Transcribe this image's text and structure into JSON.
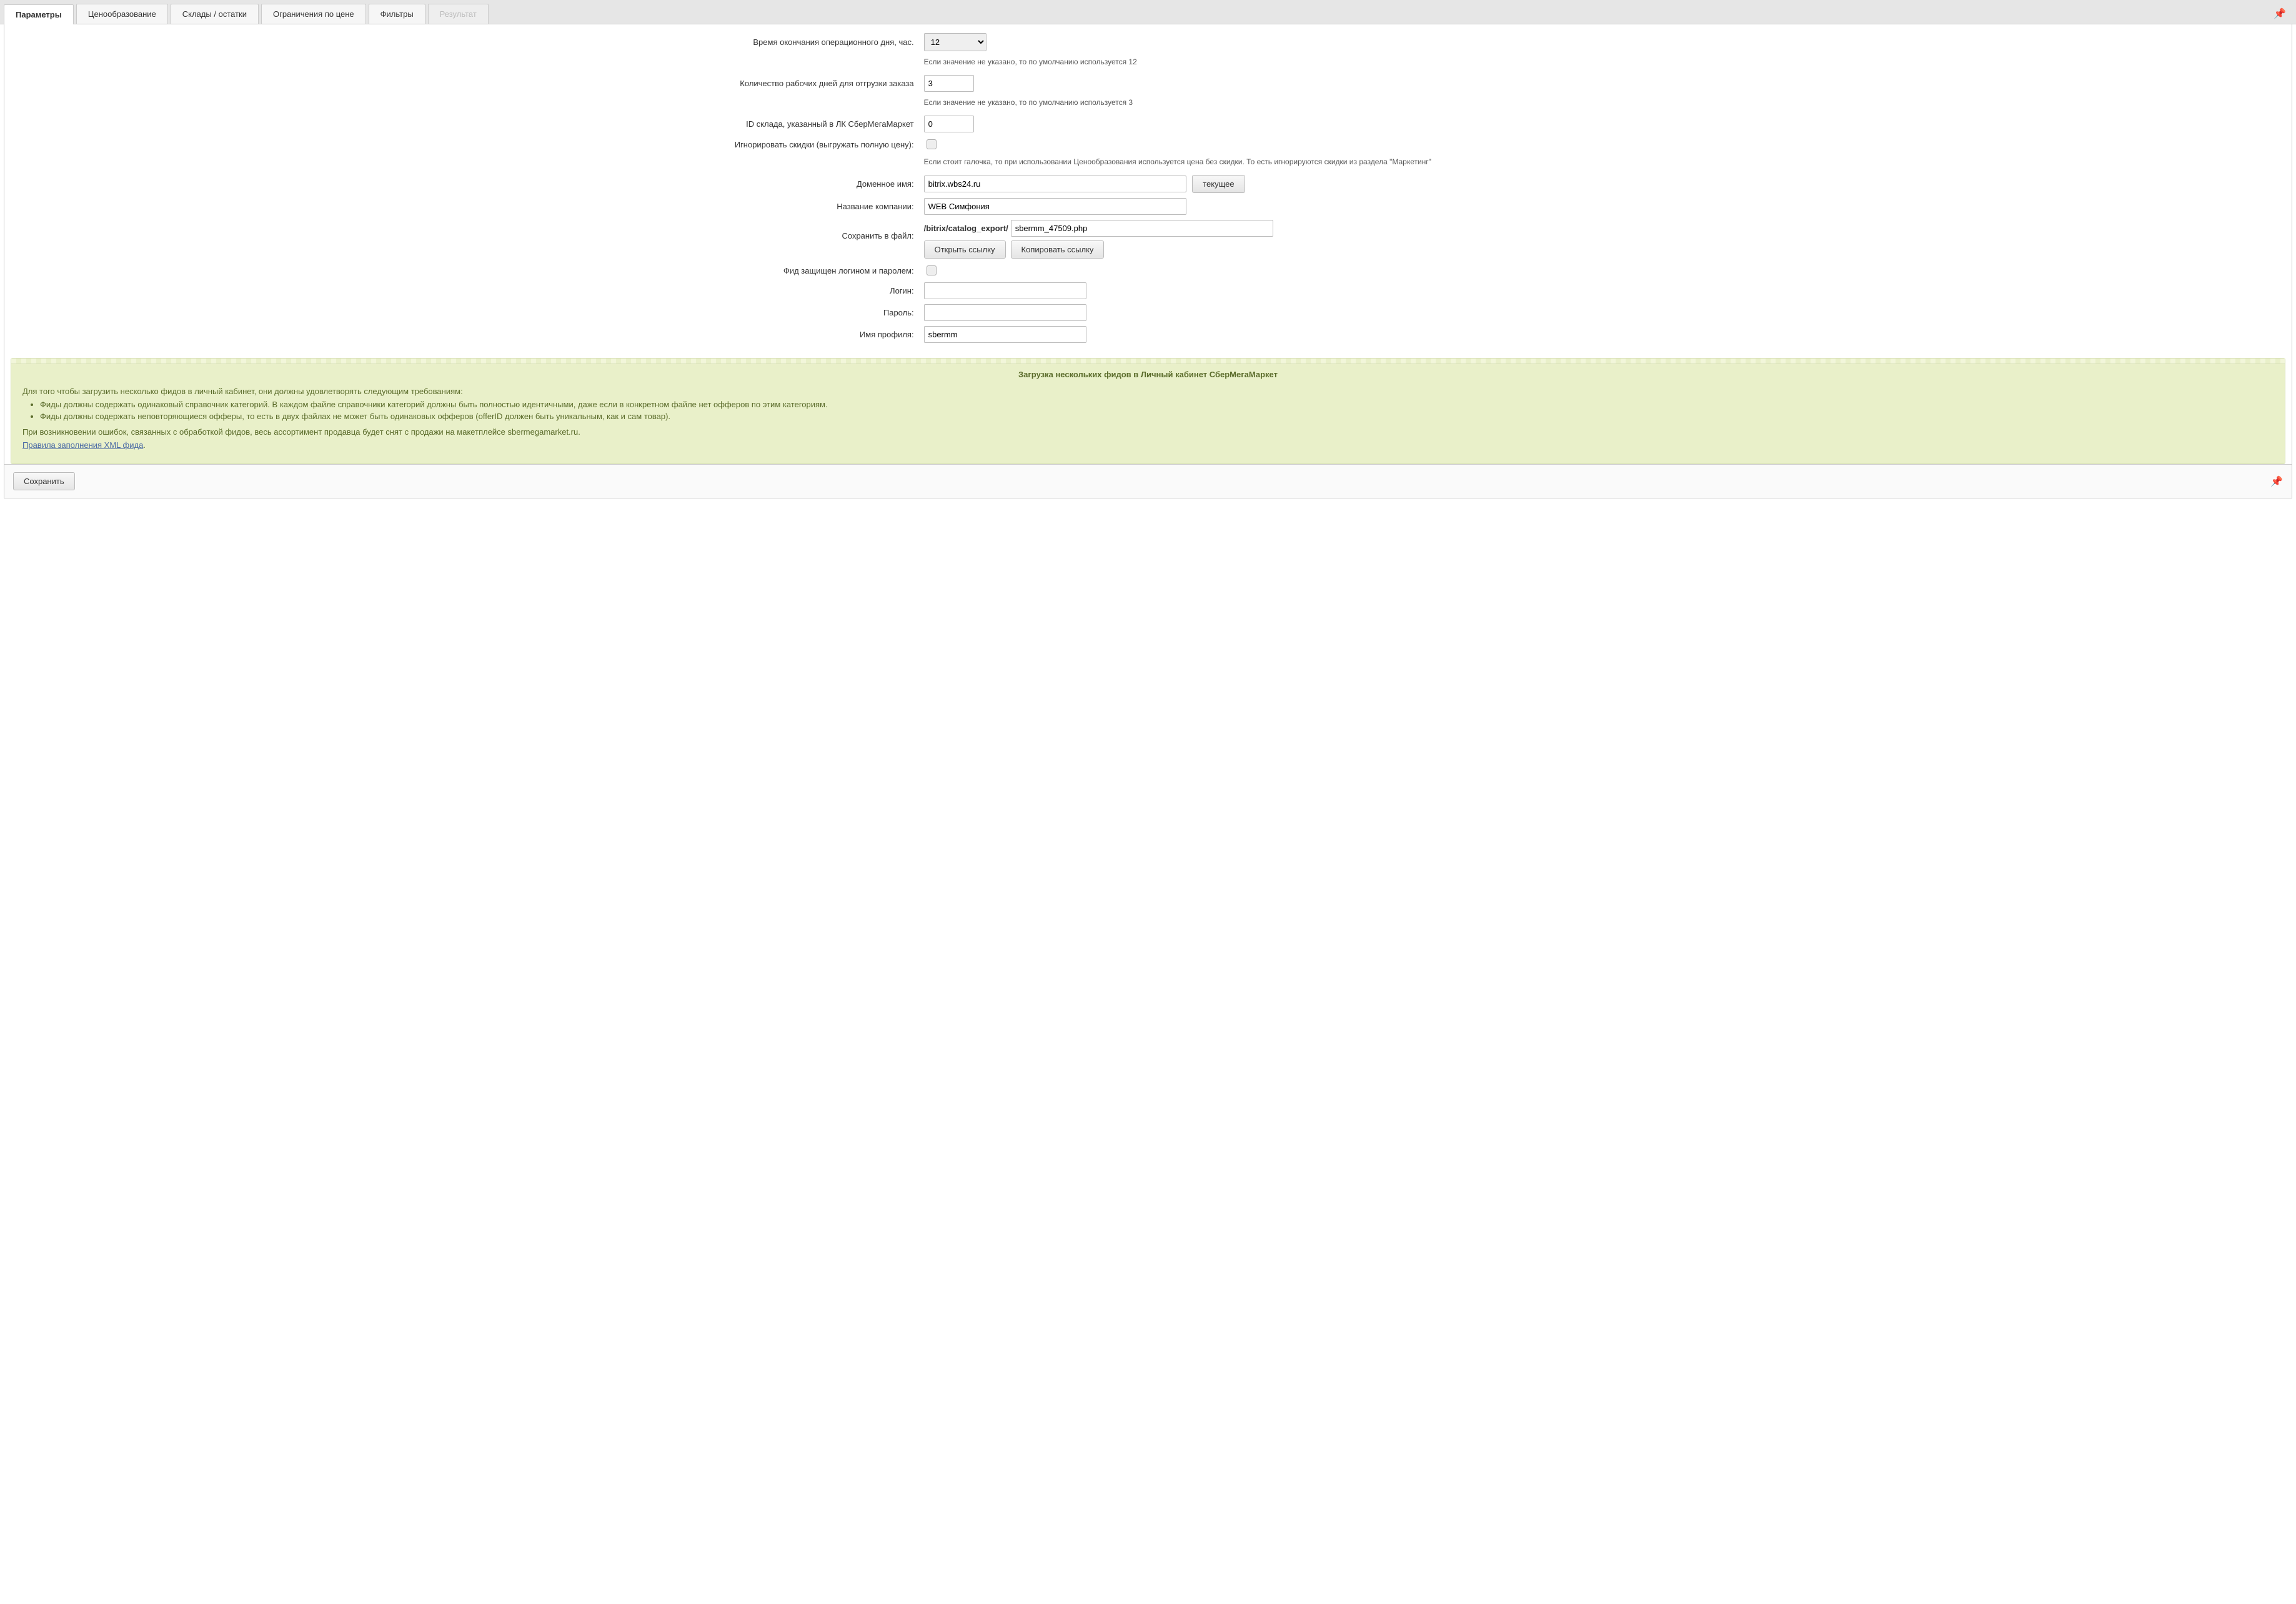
{
  "tabs": {
    "parameters": "Параметры",
    "pricing": "Ценообразование",
    "stocks": "Склады / остатки",
    "price_limits": "Ограничения по цене",
    "filters": "Фильтры",
    "result": "Результат"
  },
  "form": {
    "end_of_day_label": "Время окончания операционного дня, час.",
    "end_of_day_value": "12",
    "end_of_day_hint": "Если значение не указано, то по умолчанию используется 12",
    "workdays_label": "Количество рабочих дней для отгрузки заказа",
    "workdays_value": "3",
    "workdays_hint": "Если значение не указано, то по умолчанию используется 3",
    "warehouse_id_label": "ID склада, указанный в ЛК СберМегаМаркет",
    "warehouse_id_value": "0",
    "ignore_discounts_label": "Игнорировать скидки (выгружать полную цену):",
    "ignore_discounts_hint": "Если стоит галочка, то при использовании Ценообразования используется цена без скидки. То есть игнорируются скидки из раздела \"Маркетинг\"",
    "domain_label": "Доменное имя:",
    "domain_value": "bitrix.wbs24.ru",
    "domain_button": "текущее",
    "company_label": "Название компании:",
    "company_value": "WEB Симфония",
    "save_file_label": "Сохранить в файл:",
    "save_file_prefix": "/bitrix/catalog_export/",
    "save_file_value": "sbermm_47509.php",
    "open_link": "Открыть ссылку",
    "copy_link": "Копировать ссылку",
    "feed_protected_label": "Фид защищен логином и паролем:",
    "login_label": "Логин:",
    "login_value": "",
    "password_label": "Пароль:",
    "password_value": "",
    "profile_label": "Имя профиля:",
    "profile_value": "sbermm"
  },
  "notice": {
    "title": "Загрузка нескольких фидов в Личный кабинет СберМегаМаркет",
    "intro": "Для того чтобы загрузить несколько фидов в личный кабинет, они должны удовлетворять следующим требованиям:",
    "item1": "Фиды должны содержать одинаковый справочник категорий. В каждом файле справочники категорий должны быть полностью идентичными, даже если в конкретном файле нет офферов по этим категориям.",
    "item2": "Фиды должны содержать неповторяющиеся офферы, то есть в двух файлах не может быть одинаковых офферов (offerID должен быть уникальным, как и сам товар).",
    "footer": "При возникновении ошибок, связанных с обработкой фидов, весь ассортимент продавца будет снят с продажи на макетплейсе sbermegamarket.ru.",
    "link_text": "Правила заполнения XML фида",
    "link_suffix": "."
  },
  "buttons": {
    "save": "Сохранить"
  }
}
